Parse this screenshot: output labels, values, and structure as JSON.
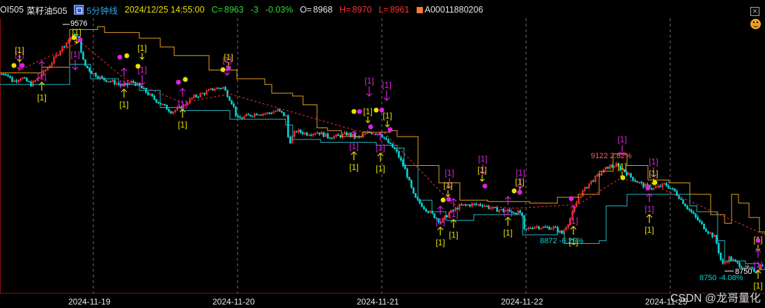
{
  "header": {
    "symbol": "OI505",
    "name": "菜籽油505",
    "period": "5分钟线",
    "datetime": "2024/12/25 14:55:00",
    "close_label": "C=",
    "close_value": "8963",
    "change": "-3",
    "change_pct": "-0.03%",
    "open_label": "O=",
    "open_value": "8968",
    "high_label": "H=",
    "high_value": "8970",
    "low_label": "L=",
    "low_value": "8961",
    "indicator": "A00011880206",
    "colors": {
      "up": "#ff3030",
      "down": "#00d8d8",
      "text": "#e8e8e8",
      "period": "#2ea8e8",
      "datetime": "#e8e000",
      "change": "#35d835"
    }
  },
  "icons": {
    "period_icon": "grid-square-icon",
    "close_icon": "close-icon",
    "emoji": "smiley-icon"
  },
  "watermark": "CSDN @龙哥量化",
  "chart_data": {
    "type": "candlestick",
    "x_ticks": [
      "2024-11-19",
      "2024-11-20",
      "2024-11-21",
      "2024-11-22",
      "2024-11-25"
    ],
    "ylim": [
      8680,
      9620
    ],
    "grid": "vertical dashed at day boundaries",
    "annotations": [
      {
        "text": "9576",
        "value": 9576,
        "kind": "high-marker",
        "color": "#ffffff"
      },
      {
        "text": "9122 2.82%",
        "value": 9122,
        "kind": "high-marker",
        "color": "#ff6060"
      },
      {
        "text": "8872 -6.25%",
        "value": 8872,
        "kind": "low-marker",
        "color": "#00d8d8"
      },
      {
        "text": "8750 -4.08%",
        "value": 8750,
        "kind": "low-marker",
        "color": "#00d8d8"
      },
      {
        "text": "8750",
        "value": 8750,
        "kind": "low-marker",
        "color": "#ffffff"
      }
    ],
    "signal_label": "[1]",
    "price_anchors": [
      [
        0,
        9435
      ],
      [
        8,
        9440
      ],
      [
        18,
        9410
      ],
      [
        30,
        9425
      ],
      [
        44,
        9400
      ],
      [
        58,
        9430
      ],
      [
        72,
        9470
      ],
      [
        86,
        9520
      ],
      [
        100,
        9560
      ],
      [
        108,
        9576
      ],
      [
        114,
        9540
      ],
      [
        120,
        9470
      ],
      [
        132,
        9440
      ],
      [
        146,
        9420
      ],
      [
        160,
        9410
      ],
      [
        176,
        9395
      ],
      [
        190,
        9410
      ],
      [
        204,
        9385
      ],
      [
        218,
        9355
      ],
      [
        232,
        9330
      ],
      [
        246,
        9305
      ],
      [
        262,
        9325
      ],
      [
        276,
        9355
      ],
      [
        292,
        9370
      ],
      [
        306,
        9385
      ],
      [
        320,
        9390
      ],
      [
        334,
        9330
      ],
      [
        340,
        9280
      ],
      [
        352,
        9290
      ],
      [
        368,
        9300
      ],
      [
        384,
        9300
      ],
      [
        398,
        9310
      ],
      [
        410,
        9290
      ],
      [
        414,
        9195
      ],
      [
        424,
        9240
      ],
      [
        440,
        9230
      ],
      [
        456,
        9235
      ],
      [
        470,
        9220
      ],
      [
        484,
        9220
      ],
      [
        498,
        9230
      ],
      [
        514,
        9215
      ],
      [
        530,
        9235
      ],
      [
        546,
        9230
      ],
      [
        554,
        9205
      ],
      [
        568,
        9170
      ],
      [
        582,
        9100
      ],
      [
        594,
        9010
      ],
      [
        608,
        8975
      ],
      [
        620,
        8950
      ],
      [
        632,
        8925
      ],
      [
        644,
        8955
      ],
      [
        660,
        8980
      ],
      [
        676,
        8985
      ],
      [
        692,
        8985
      ],
      [
        706,
        8970
      ],
      [
        720,
        8965
      ],
      [
        734,
        8960
      ],
      [
        748,
        8955
      ],
      [
        752,
        8895
      ],
      [
        766,
        8910
      ],
      [
        780,
        8905
      ],
      [
        794,
        8905
      ],
      [
        806,
        8885
      ],
      [
        818,
        8935
      ],
      [
        830,
        9010
      ],
      [
        846,
        9060
      ],
      [
        860,
        9090
      ],
      [
        872,
        9115
      ],
      [
        884,
        9120
      ],
      [
        896,
        9100
      ],
      [
        910,
        9070
      ],
      [
        924,
        9050
      ],
      [
        938,
        9040
      ],
      [
        954,
        9055
      ],
      [
        968,
        9030
      ],
      [
        984,
        8980
      ],
      [
        998,
        8940
      ],
      [
        1012,
        8900
      ],
      [
        1026,
        8870
      ],
      [
        1036,
        8775
      ],
      [
        1046,
        8800
      ],
      [
        1058,
        8780
      ],
      [
        1070,
        8765
      ],
      [
        1084,
        8755
      ],
      [
        1098,
        8790
      ]
    ],
    "series": [
      {
        "kind": "moving-average-upper",
        "color": "#e6a020",
        "points": [
          [
            0,
            9440
          ],
          [
            60,
            9460
          ],
          [
            100,
            9590
          ],
          [
            140,
            9600
          ],
          [
            150,
            9580
          ],
          [
            200,
            9560
          ],
          [
            230,
            9530
          ],
          [
            250,
            9500
          ],
          [
            300,
            9450
          ],
          [
            340,
            9420
          ],
          [
            380,
            9400
          ],
          [
            390,
            9370
          ],
          [
            420,
            9360
          ],
          [
            435,
            9330
          ],
          [
            450,
            9330
          ],
          [
            455,
            9250
          ],
          [
            470,
            9240
          ],
          [
            490,
            9220
          ],
          [
            520,
            9235
          ],
          [
            560,
            9240
          ],
          [
            570,
            9220
          ],
          [
            590,
            9220
          ],
          [
            600,
            9120
          ],
          [
            630,
            9060
          ],
          [
            650,
            9060
          ],
          [
            660,
            9000
          ],
          [
            700,
            8995
          ],
          [
            760,
            8990
          ],
          [
            790,
            8990
          ],
          [
            800,
            9010
          ],
          [
            830,
            9020
          ],
          [
            860,
            9100
          ],
          [
            880,
            9160
          ],
          [
            900,
            9120
          ],
          [
            930,
            9070
          ],
          [
            960,
            9060
          ],
          [
            990,
            9020
          ],
          [
            1020,
            8950
          ],
          [
            1040,
            8920
          ],
          [
            1050,
            9020
          ],
          [
            1060,
            8990
          ],
          [
            1075,
            8940
          ],
          [
            1090,
            8890
          ],
          [
            1098,
            8880
          ]
        ]
      },
      {
        "kind": "moving-average-lower",
        "color": "#20b8c8",
        "points": [
          [
            0,
            9400
          ],
          [
            60,
            9400
          ],
          [
            100,
            9470
          ],
          [
            130,
            9420
          ],
          [
            170,
            9400
          ],
          [
            200,
            9380
          ],
          [
            230,
            9320
          ],
          [
            260,
            9310
          ],
          [
            290,
            9310
          ],
          [
            330,
            9280
          ],
          [
            380,
            9280
          ],
          [
            410,
            9260
          ],
          [
            420,
            9210
          ],
          [
            460,
            9200
          ],
          [
            500,
            9200
          ],
          [
            540,
            9190
          ],
          [
            570,
            9180
          ],
          [
            580,
            9120
          ],
          [
            600,
            9000
          ],
          [
            620,
            8960
          ],
          [
            640,
            8930
          ],
          [
            680,
            8950
          ],
          [
            700,
            8950
          ],
          [
            720,
            8950
          ],
          [
            750,
            8880
          ],
          [
            790,
            8880
          ],
          [
            800,
            8890
          ],
          [
            810,
            8850
          ],
          [
            850,
            8850
          ],
          [
            860,
            8860
          ],
          [
            870,
            8980
          ],
          [
            900,
            9020
          ],
          [
            940,
            9020
          ],
          [
            990,
            8980
          ],
          [
            1000,
            8960
          ],
          [
            1030,
            8860
          ],
          [
            1040,
            8790
          ],
          [
            1070,
            8780
          ],
          [
            1090,
            8760
          ],
          [
            1098,
            8770
          ]
        ]
      },
      {
        "kind": "trend-line",
        "color": "#ff3030",
        "points": [
          [
            20,
            9440
          ],
          [
            115,
            9548
          ],
          [
            180,
            9418
          ],
          [
            262,
            9337
          ],
          [
            330,
            9367
          ],
          [
            512,
            9240
          ],
          [
            552,
            9232
          ],
          [
            650,
            8985
          ],
          [
            740,
            8972
          ],
          [
            830,
            8985
          ],
          [
            890,
            9075
          ],
          [
            940,
            9050
          ],
          [
            1098,
            8880
          ]
        ]
      }
    ]
  }
}
